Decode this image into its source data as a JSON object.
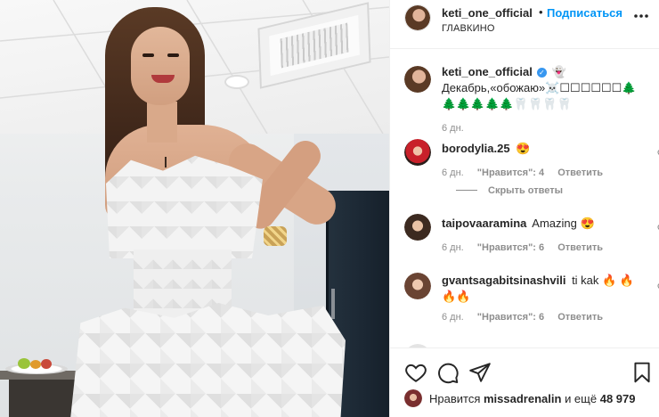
{
  "post": {
    "username": "keti_one_official",
    "follow_label": "Подписаться",
    "location": "ГЛАВКИНО",
    "dot": "•"
  },
  "comments": [
    {
      "username": "keti_one_official",
      "text": "👻 Декабрь,«обожаю»☠️☐☐☐☐☐☐🌲🌲🌲🌲🌲🌲🦷🦷🦷🦷",
      "time": "6 дн.",
      "verified": true
    },
    {
      "username": "borodylia.25",
      "text": "😍",
      "time": "6 дн.",
      "likes": "\"Нравится\": 4",
      "reply": "Ответить",
      "view_replies": "Скрыть ответы"
    },
    {
      "username": "taipovaaramina",
      "text": "Amazing 😍",
      "time": "6 дн.",
      "likes": "\"Нравится\": 6",
      "reply": "Ответить"
    },
    {
      "username": "gvantsagabitsinashvili",
      "text": "ti kak 🔥 🔥🔥🔥",
      "time": "6 дн.",
      "likes": "\"Нравится\": 6",
      "reply": "Ответить"
    }
  ],
  "likes": {
    "prefix": "Нравится",
    "user": "missadrenalin",
    "suffix": "и ещё",
    "count": "48 979"
  },
  "icons": {
    "more": "more-horizontal-icon",
    "comment_like": "heart-outline-icon",
    "like": "heart-outline-icon",
    "comment": "comment-bubble-icon",
    "share": "paper-plane-icon",
    "save": "bookmark-icon",
    "verified": "verified-badge-icon"
  },
  "colors": {
    "link_blue": "#0095f6",
    "text": "#262626",
    "secondary": "#8e8e8e",
    "border": "#efefef"
  }
}
